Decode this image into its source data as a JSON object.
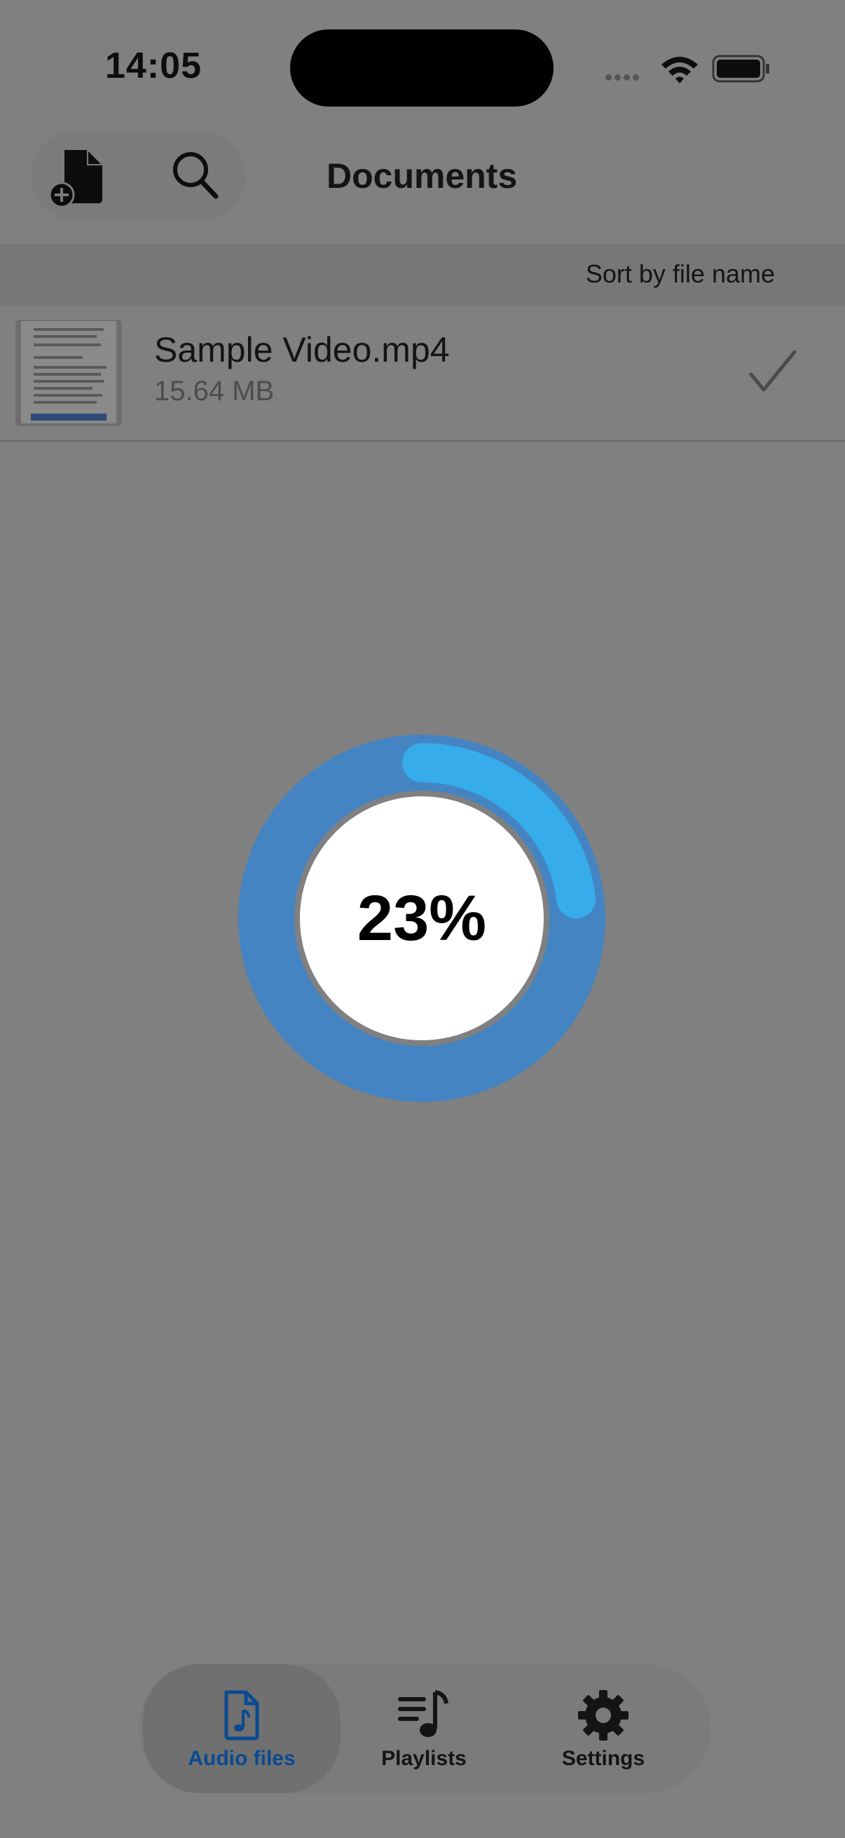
{
  "status": {
    "time": "14:05"
  },
  "header": {
    "title": "Documents"
  },
  "sort": {
    "label": "Sort by file name"
  },
  "files": [
    {
      "name": "Sample Video.mp4",
      "size": "15.64 MB",
      "selected": true
    }
  ],
  "progress": {
    "label": "23%",
    "value": 0.23,
    "track_color": "#4484c2",
    "fill_color": "#36acea"
  },
  "tabs": [
    {
      "label": "Audio files",
      "icon": "audio-file-icon",
      "active": true
    },
    {
      "label": "Playlists",
      "icon": "playlist-icon",
      "active": false
    },
    {
      "label": "Settings",
      "icon": "gear-icon",
      "active": false
    }
  ],
  "colors": {
    "accent": "#0a4a90",
    "dim_overlay": "#808080"
  }
}
